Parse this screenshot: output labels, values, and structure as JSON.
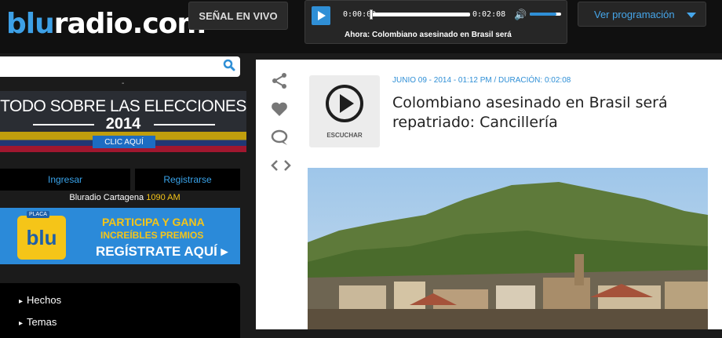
{
  "header": {
    "logo_prefix": "blu",
    "logo_suffix": "radio.com",
    "live_label": "SEÑAL EN VIVO",
    "programming_label": "Ver programación"
  },
  "player": {
    "current_time": "0:00:00",
    "duration": "0:02:08",
    "now_playing": "Ahora: Colombiano asesinado en Brasil será",
    "progress": 0.0,
    "volume": 0.85
  },
  "sidebar": {
    "search_placeholder": "",
    "dash": "-",
    "elections_banner": {
      "line1": "TODO SOBRE LAS ELECCIONES",
      "year": "2014",
      "cta": "CLIC AQUÍ"
    },
    "login_label": "Ingresar",
    "register_label": "Registrarse",
    "station_name": "Bluradio Cartagena",
    "station_freq": "1090 AM",
    "promo": {
      "badge_tag": "PLACA",
      "badge_text": "blu",
      "line1": "PARTICIPA Y GANA",
      "line2": "INCREÍBLES PREMIOS",
      "line3": "REGÍSTRATE AQUÍ ▸"
    },
    "menu": [
      "Hechos",
      "Temas"
    ]
  },
  "article": {
    "listen_label": "ESCUCHAR",
    "meta": "JUNIO 09 - 2014 - 01:12 PM / DURACIÓN: 0:02:08",
    "title": "Colombiano asesinado en Brasil será repatriado: Cancillería"
  },
  "icons": [
    "search-icon",
    "play-icon",
    "volume-icon",
    "caret-down-icon",
    "share-icon",
    "heart-icon",
    "comment-icon",
    "code-icon",
    "play-circle-icon"
  ],
  "colors": {
    "accent": "#2f8fd6",
    "highlight": "#f5c518",
    "background": "#1b1b1b"
  }
}
